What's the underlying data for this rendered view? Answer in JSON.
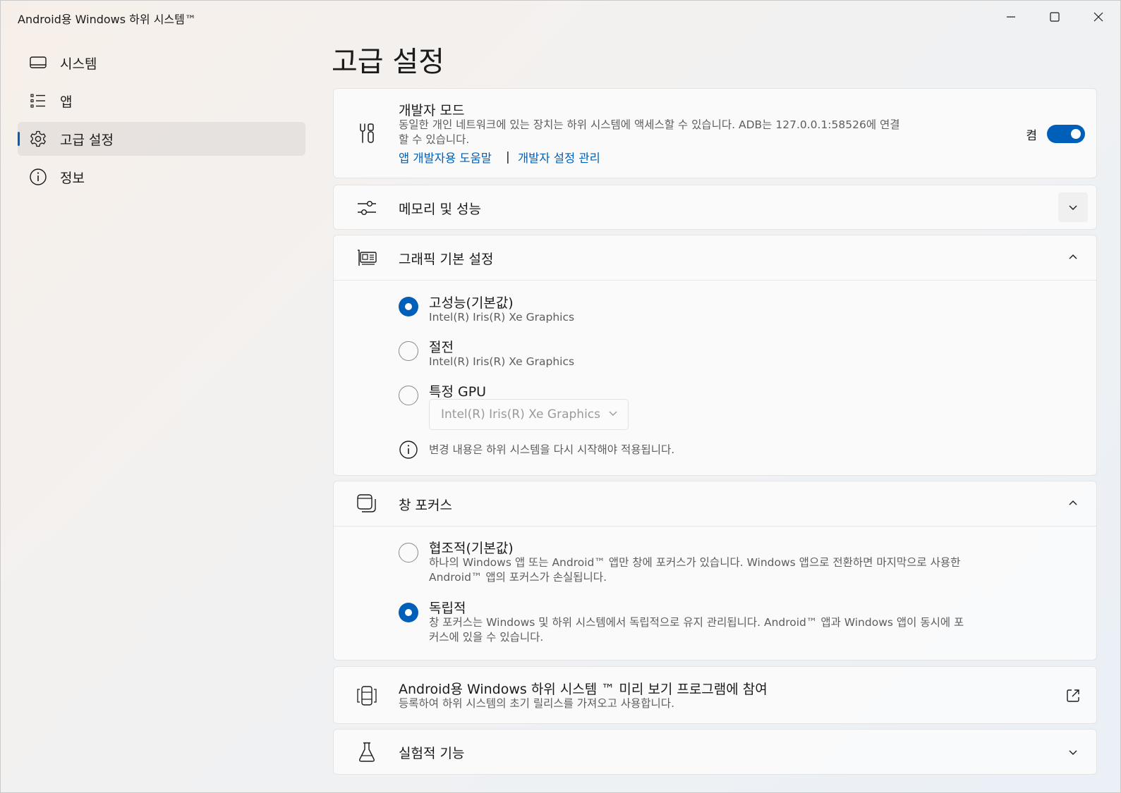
{
  "window": {
    "title": "Android용 Windows 하위 시스템™",
    "controls": {
      "minimize": "minimize-icon",
      "maximize": "maximize-icon",
      "close": "close-icon"
    }
  },
  "sidebar": {
    "items": [
      {
        "label": "시스템",
        "icon": "laptop-icon",
        "selected": false
      },
      {
        "label": "앱",
        "icon": "list-icon",
        "selected": false
      },
      {
        "label": "고급 설정",
        "icon": "gear-icon",
        "selected": true
      },
      {
        "label": "정보",
        "icon": "info-icon",
        "selected": false
      }
    ]
  },
  "page": {
    "title": "고급 설정"
  },
  "developer_mode": {
    "title": "개발자 모드",
    "description_line1": "동일한 개인 네트워크에 있는 장치는 하위 시스템에 액세스할 수 있습니다. ADB는 127.0.0.1:58526에 연결",
    "description_line2": "할 수 있습니다.",
    "link_help": "앱 개발자용 도움말",
    "separator": "|",
    "link_manage": "개발자 설정 관리",
    "toggle_label": "켬",
    "toggle_on": true
  },
  "memory": {
    "title": "메모리 및 성능",
    "expanded": false
  },
  "graphics": {
    "title": "그래픽 기본 설정",
    "expanded": true,
    "options": [
      {
        "label": "고성능(기본값)",
        "sub": "Intel(R) Iris(R) Xe Graphics",
        "selected": true
      },
      {
        "label": "절전",
        "sub": "Intel(R) Iris(R) Xe Graphics",
        "selected": false
      },
      {
        "label": "특정 GPU",
        "selected": false
      }
    ],
    "gpu_select_value": "Intel(R) Iris(R) Xe Graphics",
    "notice": "변경 내용은 하위 시스템을 다시 시작해야 적용됩니다."
  },
  "focus": {
    "title": "창 포커스",
    "expanded": true,
    "options": [
      {
        "label": "협조적(기본값)",
        "sub_line1": "하나의 Windows 앱 또는 Android™ 앱만 창에 포커스가 있습니다. Windows 앱으로 전환하면 마지막으로 사용한",
        "sub_line2": "Android™ 앱의 포커스가 손실됩니다.",
        "selected": false
      },
      {
        "label": "독립적",
        "sub_line1": "창 포커스는 Windows 및 하위 시스템에서 독립적으로 유지 관리됩니다. Android™ 앱과 Windows 앱이 동시에 포",
        "sub_line2": "커스에 있을 수 있습니다.",
        "selected": true
      }
    ]
  },
  "preview": {
    "title": "Android용 Windows 하위 시스템 ™ 미리 보기 프로그램에 참여",
    "description": "등록하여 하위 시스템의 초기 릴리스를 가져오고 사용합니다."
  },
  "experimental": {
    "title": "실험적 기능",
    "expanded": false
  },
  "colors": {
    "accent": "#005fb8"
  }
}
